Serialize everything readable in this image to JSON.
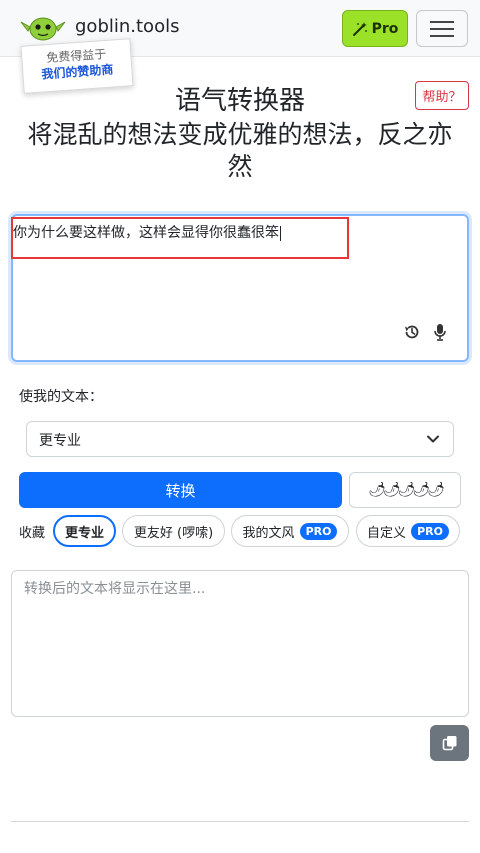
{
  "header": {
    "site_name": "goblin.tools",
    "pro_label": "Pro",
    "accent": "#9be127"
  },
  "sponsor": {
    "line1": "免费得益于",
    "line2": "我们的赞助商"
  },
  "page": {
    "title": "语气转换器",
    "subtitle": "将混乱的想法变成优雅的想法，反之亦然",
    "help_label": "帮助？"
  },
  "input": {
    "value": "你为什么要这样做，这样会显得你很蠢很笨",
    "icons": [
      "history-icon",
      "microphone-icon"
    ]
  },
  "style_select": {
    "label": "使我的文本：",
    "selected": "更专业"
  },
  "actions": {
    "convert_label": "转换",
    "spice_level": "🌶🌶🌶🌶🌶",
    "primary_color": "#0d6efd"
  },
  "favorites": {
    "label": "收藏",
    "chips": [
      {
        "label": "更专业",
        "active": true,
        "pro": ""
      },
      {
        "label": "更友好 (啰嗦)",
        "active": false,
        "pro": ""
      },
      {
        "label": "我的文风",
        "active": false,
        "pro": "PRO"
      },
      {
        "label": "自定义",
        "active": false,
        "pro": "PRO"
      }
    ]
  },
  "output": {
    "placeholder": "转换后的文本将显示在这里..."
  }
}
